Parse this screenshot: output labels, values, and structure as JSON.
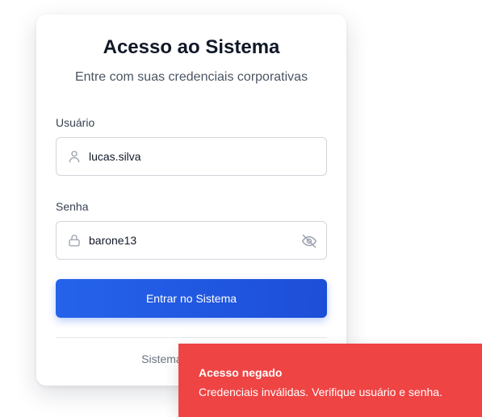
{
  "login": {
    "title": "Acesso ao Sistema",
    "subtitle": "Entre com suas credenciais corporativas",
    "username_label": "Usuário",
    "username_value": "lucas.silva",
    "password_label": "Senha",
    "password_value": "barone13",
    "submit_label": "Entrar no Sistema",
    "footer_text": "Sistema corporativo"
  },
  "icons": {
    "username": "user-icon",
    "password": "lock-icon",
    "toggle_password": "eye-off-icon"
  },
  "toast": {
    "title": "Acesso negado",
    "message": "Credenciais inválidas. Verifique usuário e senha.",
    "color": "#ef4444"
  },
  "colors": {
    "primary": "#2563eb",
    "primary_dark": "#1d4ed8",
    "error": "#ef4444"
  }
}
